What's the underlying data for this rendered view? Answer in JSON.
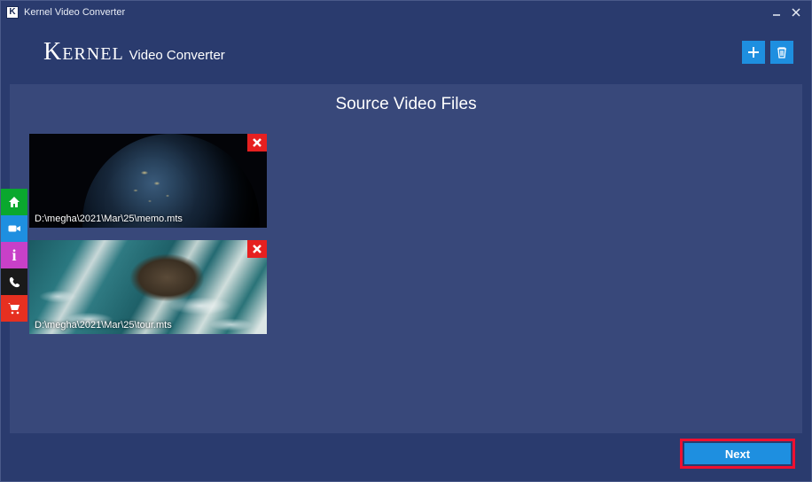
{
  "window": {
    "title": "Kernel Video Converter",
    "icon_letter": "K"
  },
  "brand": {
    "main": "Kernel",
    "sub": "Video Converter"
  },
  "toolbar": {
    "add_icon": "plus-icon",
    "delete_icon": "trash-icon"
  },
  "panel": {
    "title": "Source Video Files"
  },
  "files": [
    {
      "path": "D:\\megha\\2021\\Mar\\25\\memo.mts",
      "thumb": "earth"
    },
    {
      "path": "D:\\megha\\2021\\Mar\\25\\tour.mts",
      "thumb": "ocean"
    }
  ],
  "side": {
    "items": [
      {
        "name": "home-icon"
      },
      {
        "name": "video-icon"
      },
      {
        "name": "info-icon"
      },
      {
        "name": "phone-icon"
      },
      {
        "name": "cart-icon"
      }
    ]
  },
  "footer": {
    "next_label": "Next"
  },
  "colors": {
    "accent": "#1e8fe0",
    "highlight_border": "#f01030"
  }
}
